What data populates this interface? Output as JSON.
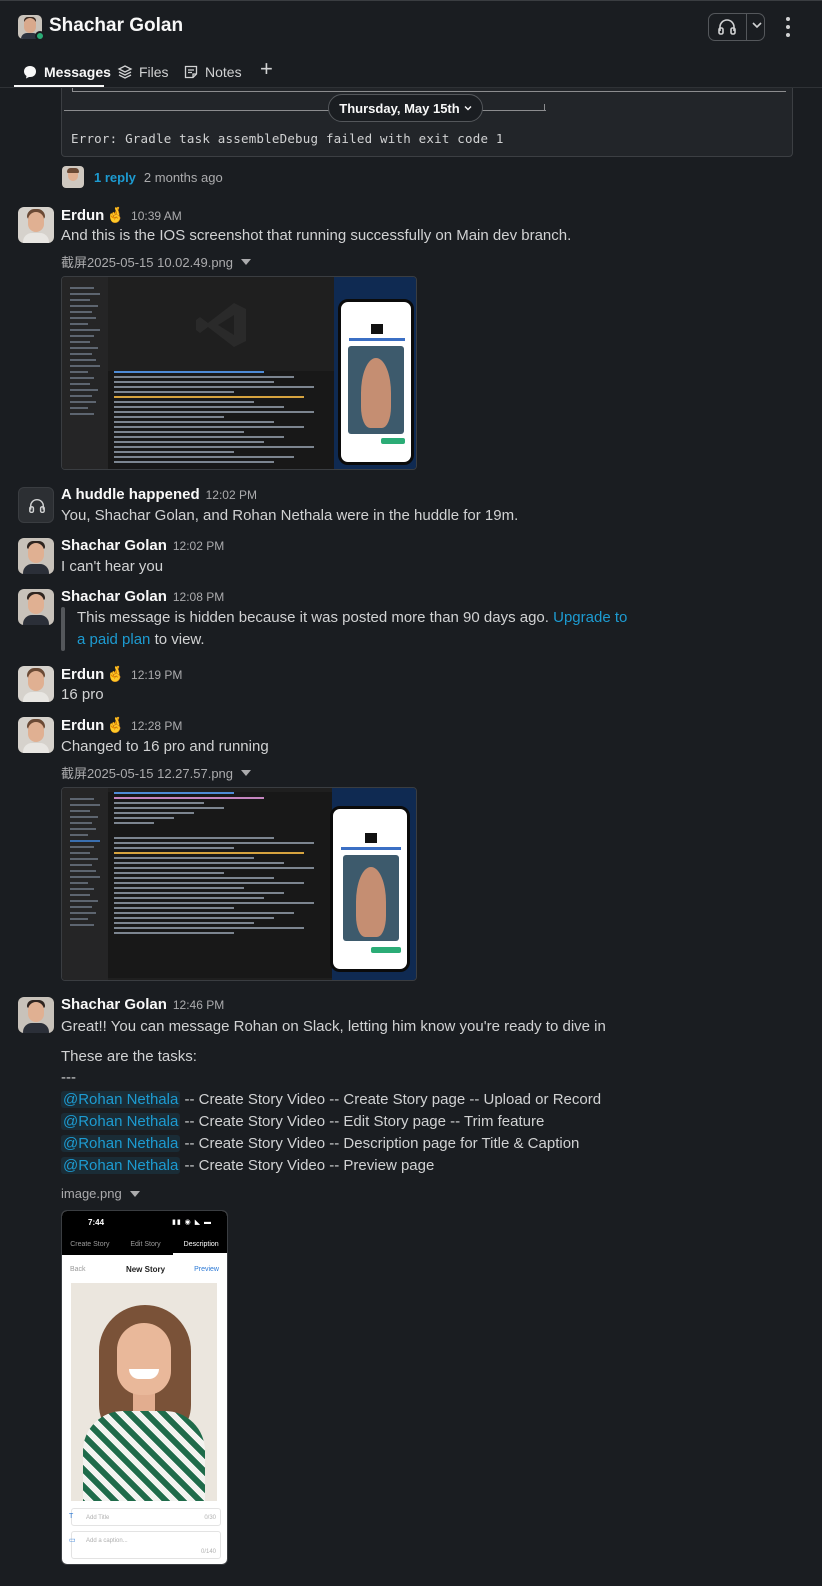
{
  "header": {
    "title": "Shachar Golan",
    "tabs": [
      {
        "label": "Messages",
        "icon": "messages-icon"
      },
      {
        "label": "Files",
        "icon": "files-icon"
      },
      {
        "label": "Notes",
        "icon": "notes-icon"
      }
    ],
    "add_tab": "+"
  },
  "date_divider": "Thursday, May 15th",
  "code_block": {
    "error_line": "Error: Gradle task assembleDebug failed with exit code 1"
  },
  "thread": {
    "reply_count": "1 reply",
    "reply_time": "2 months ago"
  },
  "messages": [
    {
      "author": "Erdun",
      "emoji": "🤞",
      "time": "10:39 AM",
      "text": "And this is the IOS screenshot that running successfully on Main dev branch.",
      "file": "截屏2025-05-15 10.02.49.png"
    },
    {
      "author": "A huddle happened",
      "time": "12:02 PM",
      "text": "You, Shachar Golan, and Rohan Nethala were in the huddle for 19m."
    },
    {
      "author": "Shachar Golan",
      "time": "12:02 PM",
      "text": "I can't hear you"
    },
    {
      "author": "Shachar Golan",
      "time": "12:08 PM",
      "hidden_text": "This message is hidden because it was posted more than 90 days ago.",
      "upgrade_link": "Upgrade to a paid plan",
      "hidden_suffix": "to view."
    },
    {
      "author": "Erdun",
      "emoji": "🤞",
      "time": "12:19 PM",
      "text": "16 pro"
    },
    {
      "author": "Erdun",
      "emoji": "🤞",
      "time": "12:28 PM",
      "text": "Changed to 16 pro and running",
      "file": "截屏2025-05-15 12.27.57.png"
    },
    {
      "author": "Shachar Golan",
      "time": "12:46 PM",
      "text": "Great!! You can message Rohan on Slack, letting him know you're ready to dive in",
      "tasks_intro": "These are the tasks:",
      "separator": "---",
      "mention": "@Rohan Nethala",
      "tasks": [
        " -- Create Story Video -- Create Story page -- Upload or Record",
        " -- Create Story Video -- Edit Story page -- Trim feature",
        " -- Create Story Video -- Description page for Title & Caption",
        " -- Create Story Video -- Preview page"
      ],
      "file": "image.png"
    }
  ],
  "task_screenshot": {
    "clock": "7:44",
    "tabs": [
      "Create Story",
      "Edit Story",
      "Description"
    ],
    "back": "Back",
    "title": "New Story",
    "preview": "Preview",
    "add_title": "Add Title",
    "title_count": "0/30",
    "add_caption": "Add a caption...",
    "caption_count": "0/140"
  },
  "colors": {
    "background": "#1a1d21",
    "link": "#1d9bd1",
    "presence": "#2bac76"
  }
}
